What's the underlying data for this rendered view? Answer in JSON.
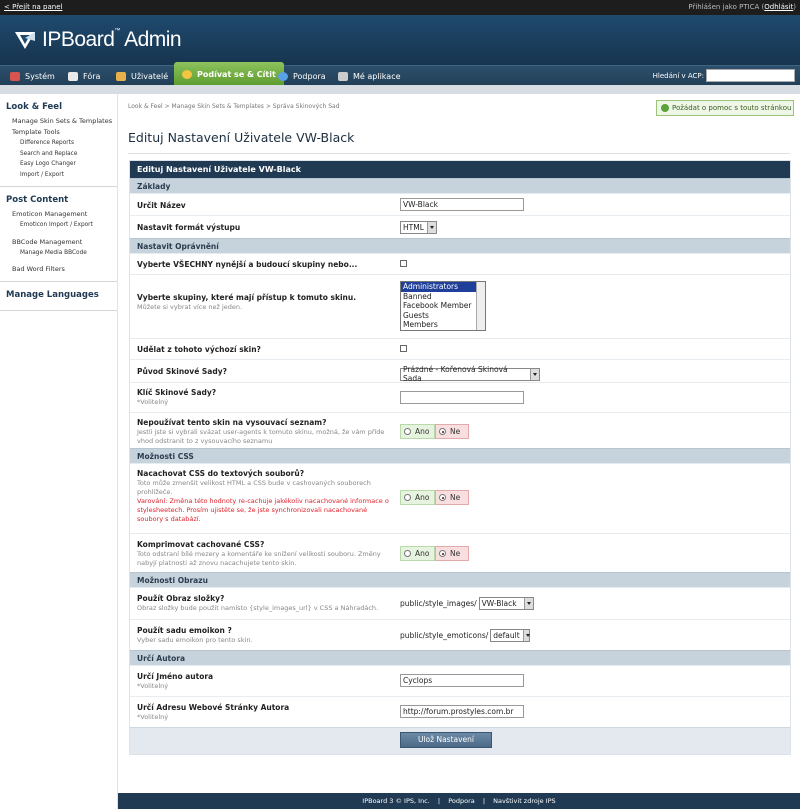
{
  "topbar": {
    "back_link": "< Přejít na panel",
    "logged_in_prefix": "Přihlášen jako PTICA (",
    "logout": "Odhlásit",
    "logged_in_suffix": ")"
  },
  "header": {
    "logo_text": "IPBoard",
    "logo_tm": "™",
    "logo_suffix": " Admin"
  },
  "nav": {
    "items": [
      {
        "label": "Systém",
        "color": "#d9534f"
      },
      {
        "label": "Fóra",
        "color": "#f0f0f0"
      },
      {
        "label": "Uživatelé",
        "color": "#e8b04a"
      },
      {
        "label": "Podívat se & Cítit",
        "color": "#f4c542"
      },
      {
        "label": "Podpora",
        "color": "#5aa0e6"
      },
      {
        "label": "Mé aplikace",
        "color": "#cccccc"
      }
    ],
    "search_label": "Hledání v ACP:",
    "search_value": ""
  },
  "sidebar": {
    "sections": [
      {
        "title": "Look & Feel",
        "items": [
          {
            "label": "Manage Skin Sets & Templates",
            "level": 1
          },
          {
            "label": "Template Tools",
            "level": 1
          },
          {
            "label": "Difference Reports",
            "level": 2
          },
          {
            "label": "Search and Replace",
            "level": 2
          },
          {
            "label": "Easy Logo Changer",
            "level": 2
          },
          {
            "label": "Import / Export",
            "level": 2
          }
        ]
      },
      {
        "title": "Post Content",
        "items": [
          {
            "label": "Emoticon Management",
            "level": 1
          },
          {
            "label": "Emoticon Import / Export",
            "level": 2
          },
          {
            "label": "BBCode Management",
            "level": 1
          },
          {
            "label": "Manage Media BBCode",
            "level": 2
          },
          {
            "label": "Bad Word Filters",
            "level": 1
          }
        ]
      },
      {
        "title": "Manage Languages",
        "items": []
      }
    ]
  },
  "content": {
    "breadcrumb": "Look & Feel  >  Manage Skin Sets & Templates  >  Správa Skinových Sad",
    "help_button": "Požádat o pomoc s touto stránkou",
    "page_title": "Edituj Nastavení Uživatele VW-Black"
  },
  "form": {
    "title": "Edituj Nastavení Uživatele VW-Black",
    "sec_basic": "Základy",
    "name_label": "Určit Název",
    "name_value": "VW-Black",
    "output_label": "Nastavit formát výstupu",
    "output_value": "HTML",
    "sec_perms": "Nastavit Oprávnění",
    "all_groups_label": "Vyberte VŠECHNY nynější a budoucí skupiny nebo...",
    "groups_label": "Vyberte skupiny, které mají přístup k tomuto skinu.",
    "groups_desc": "Můžete si vybrat více než jeden.",
    "groups_options": [
      "Administrators",
      "Banned",
      "Facebook Member",
      "Guests",
      "Members"
    ],
    "default_label": "Udělat z tohoto výchozí skin?",
    "origin_label": "Původ Skinové Sady?",
    "origin_value": "Prázdné - Kořenová Skinová Sada",
    "key_label": "Klíč Skinové Sady?",
    "key_desc": "*Volitelný",
    "key_value": "",
    "hide_label": "Nepoužívat tento skin na vysouvací seznam?",
    "hide_desc": "Jestli jste si vybrali svázat user-agents k tomuto skinu, možná, že vám příde vhod odstranit to z vysouvacího seznamu",
    "yes": "Ano",
    "no": "Ne",
    "sec_css": "Možnosti CSS",
    "cache_label": "Nacachovat CSS do textových souborů?",
    "cache_desc": "Toto může zmenšit velikost HTML a CSS bude v cashovaných souborech prohlížeče.",
    "cache_warn": "Varování: Změna této hodnoty re-cachuje jakékoliv nacachované informace o stylesheetech. Prosím ujistěte se, že jste synchronizovali nacachované soubory s databází.",
    "compress_label": "Komprimovat cachované CSS?",
    "compress_desc": "Toto odstraní bílé mezery a komentáře ke snížení velikosti souboru. Změny nabyjí platnosti až znovu nacachujete tento skin.",
    "sec_images": "Možnosti Obrazu",
    "imgdir_label": "Použít Obraz složky?",
    "imgdir_desc": "Obraz složky bude použit namísto {style_images_url} v CSS a Náhradách.",
    "imgdir_prefix": "public/style_images/",
    "imgdir_value": "VW-Black",
    "emo_label": "Použít sadu emoikon ?",
    "emo_desc": "Vyber sadu emoikon pro tento skin.",
    "emo_prefix": "public/style_emoticons/",
    "emo_value": "default",
    "sec_author": "Určí Autora",
    "author_label": "Určí Jméno autora",
    "author_desc": "*Volitelný",
    "author_value": "Cyclops",
    "url_label": "Určí Adresu Webové Stránky Autora",
    "url_desc": "*Volitelný",
    "url_value": "http://forum.prostyles.com.br",
    "submit": "Ulož Nastavení"
  },
  "footer": {
    "copyright": "IPBoard 3 © IPS, Inc.",
    "sep": "|",
    "portal": "Podpora",
    "resources": "Navštivit zdroje IPS"
  }
}
